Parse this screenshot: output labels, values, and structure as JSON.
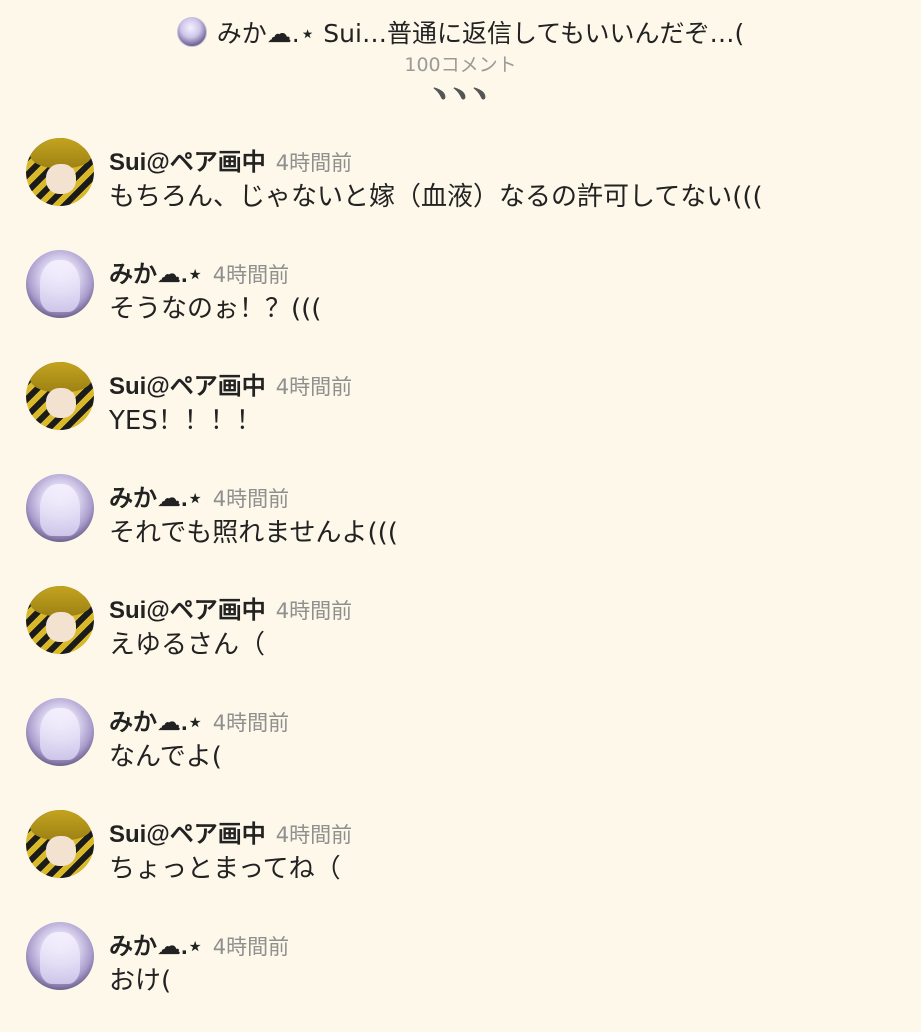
{
  "header": {
    "title": "みか☁︎.⋆ Sui…普通に返信してもいいんだぞ…(",
    "comment_count": "100コメント",
    "more_indicator": "﹅﹅﹅"
  },
  "comments": [
    {
      "author": "Sui@ペア画中",
      "time": "4時間前",
      "text": "もちろん、じゃないと嫁（血液）なるの許可してない((("
    },
    {
      "author": "みか☁︎.⋆",
      "time": "4時間前",
      "text": "そうなのぉ！？((("
    },
    {
      "author": "Sui@ペア画中",
      "time": "4時間前",
      "text": "YES！！！！"
    },
    {
      "author": "みか☁︎.⋆",
      "time": "4時間前",
      "text": "それでも照れませんよ((("
    },
    {
      "author": "Sui@ペア画中",
      "time": "4時間前",
      "text": "えゆるさん（"
    },
    {
      "author": "みか☁︎.⋆",
      "time": "4時間前",
      "text": "なんでよ("
    },
    {
      "author": "Sui@ペア画中",
      "time": "4時間前",
      "text": "ちょっとまってね（"
    },
    {
      "author": "みか☁︎.⋆",
      "time": "4時間前",
      "text": "おけ("
    }
  ]
}
